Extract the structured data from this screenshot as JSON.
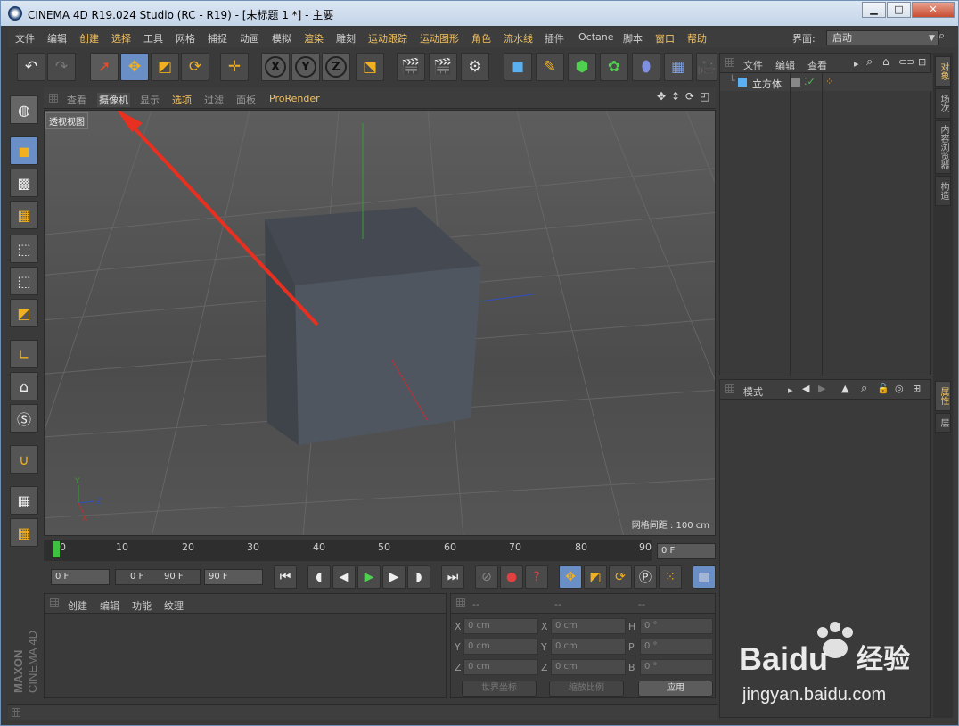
{
  "window": {
    "title": "CINEMA 4D R19.024 Studio (RC - R19) - [未标题 1 *] - 主要"
  },
  "menu": {
    "items": [
      "文件",
      "编辑",
      "创建",
      "选择",
      "工具",
      "网格",
      "捕捉",
      "动画",
      "模拟",
      "渲染",
      "雕刻",
      "运动跟踪",
      "运动图形",
      "角色",
      "流水线",
      "插件",
      "Octane",
      "脚本",
      "窗口",
      "帮助"
    ],
    "layout_label": "界面:",
    "layout_value": "启动"
  },
  "viewport": {
    "menu": [
      "查看",
      "摄像机",
      "显示",
      "选项",
      "过滤",
      "面板",
      "ProRender"
    ],
    "camera_label": "透视视图",
    "grid_spacing": "网格间距 : 100 cm"
  },
  "timeline": {
    "ticks": [
      "0",
      "10",
      "20",
      "30",
      "40",
      "50",
      "60",
      "70",
      "80",
      "90"
    ],
    "current_frame": "0 F",
    "start": "0 F",
    "range_start": "0 F",
    "range_end": "90 F",
    "end": "90 F"
  },
  "material_panel": {
    "menu": [
      "创建",
      "编辑",
      "功能",
      "纹理"
    ]
  },
  "coord_panel": {
    "header": [
      "--",
      "--",
      "--"
    ],
    "rows": [
      {
        "a": "X",
        "av": "0 cm",
        "b": "X",
        "bv": "0 cm",
        "c": "H",
        "cv": "0 °"
      },
      {
        "a": "Y",
        "av": "0 cm",
        "b": "Y",
        "bv": "0 cm",
        "c": "P",
        "cv": "0 °"
      },
      {
        "a": "Z",
        "av": "0 cm",
        "b": "Z",
        "bv": "0 cm",
        "c": "B",
        "cv": "0 °"
      }
    ],
    "world_coords": "世界坐标",
    "scale_ratio": "缩放比例",
    "apply": "应用"
  },
  "object_panel": {
    "menu": [
      "文件",
      "编辑",
      "查看"
    ],
    "object_name": "立方体"
  },
  "attr_panel": {
    "menu": "模式"
  },
  "right_tabs": {
    "top": [
      "对象",
      "场次",
      "内容浏览器",
      "构造"
    ],
    "bottom": [
      "属性",
      "层"
    ]
  },
  "branding": {
    "maxon": "MAXON",
    "c4d": "CINEMA 4D"
  },
  "watermark": {
    "brand": "Baidu",
    "cn": "经验",
    "url": "jingyan.baidu.com"
  }
}
